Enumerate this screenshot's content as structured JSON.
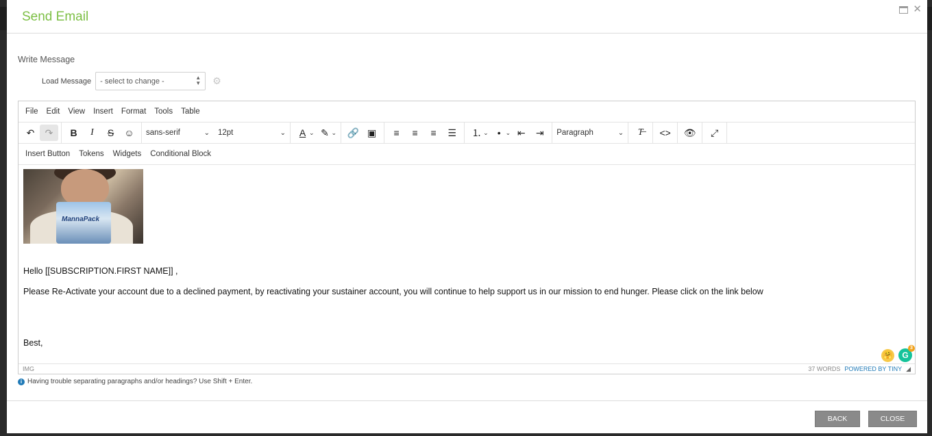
{
  "dialog": {
    "title": "Send Email",
    "maximize_icon": "maximize-icon",
    "close_icon": "close-icon"
  },
  "section_label": "Write Message",
  "load_message": {
    "label": "Load Message",
    "selected": "- select to change -"
  },
  "editor": {
    "menubar": [
      "File",
      "Edit",
      "View",
      "Insert",
      "Format",
      "Tools",
      "Table"
    ],
    "toolbar": {
      "font_family": "sans-serif",
      "font_size": "12pt",
      "block_format": "Paragraph"
    },
    "toolbar2": [
      "Insert Button",
      "Tokens",
      "Widgets",
      "Conditional Block"
    ],
    "image_text": "MannaPack",
    "body": {
      "greeting": "Hello [[SUBSCRIPTION.FIRST NAME]] ,",
      "message": "Please Re-Activate your account due to a declined payment, by reactivating your sustainer account, you will continue to help support us in our mission to end hunger. Please click on the link below",
      "signoff": "Best,"
    },
    "grammarly_badge": "3",
    "statusbar": {
      "path": "IMG",
      "word_count": "37 WORDS",
      "powered_by": "POWERED BY TINY"
    }
  },
  "hint": "Having trouble separating paragraphs and/or headings? Use Shift + Enter.",
  "footer": {
    "back_label": "BACK",
    "close_label": "CLOSE"
  },
  "colors": {
    "title": "#7cbf44",
    "button_bg": "#8a8a8a",
    "link": "#207ab7"
  }
}
